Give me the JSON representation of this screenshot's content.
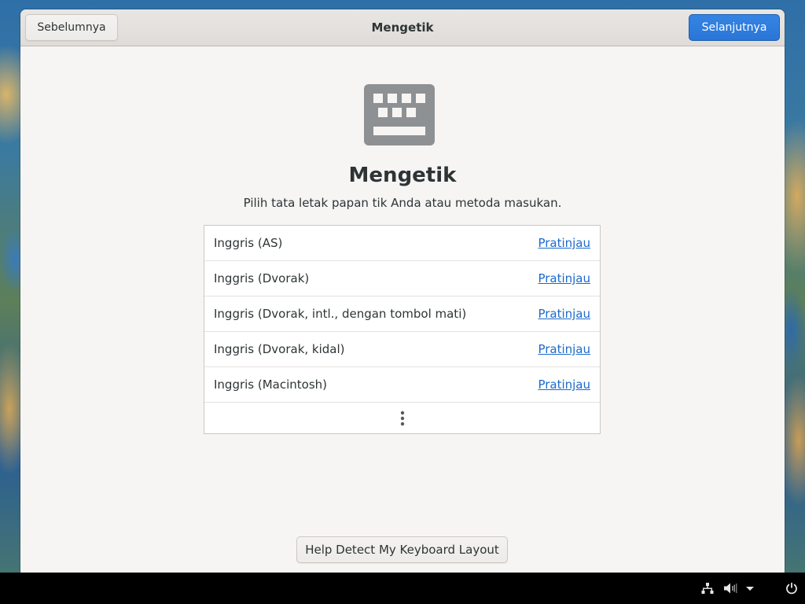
{
  "header": {
    "prev_label": "Sebelumnya",
    "title": "Mengetik",
    "next_label": "Selanjutnya"
  },
  "main": {
    "icon": "keyboard-icon",
    "title": "Mengetik",
    "subtitle": "Pilih tata letak papan tik Anda atau metoda masukan.",
    "layouts": [
      {
        "name": "Inggris (AS)",
        "preview_label": "Pratinjau"
      },
      {
        "name": "Inggris (Dvorak)",
        "preview_label": "Pratinjau"
      },
      {
        "name": "Inggris (Dvorak, intl., dengan tombol mati)",
        "preview_label": "Pratinjau"
      },
      {
        "name": "Inggris (Dvorak, kidal)",
        "preview_label": "Pratinjau"
      },
      {
        "name": "Inggris (Macintosh)",
        "preview_label": "Pratinjau"
      }
    ],
    "more_icon": "more-vertical-icon",
    "detect_button_label": "Help Detect My Keyboard Layout"
  },
  "panel": {
    "icons": [
      "network-icon",
      "volume-icon",
      "dropdown-arrow-icon",
      "power-icon"
    ]
  },
  "colors": {
    "accent": "#3584e4",
    "link": "#1b6acb",
    "window_bg": "#f6f5f4",
    "panel_bg": "#000000"
  }
}
